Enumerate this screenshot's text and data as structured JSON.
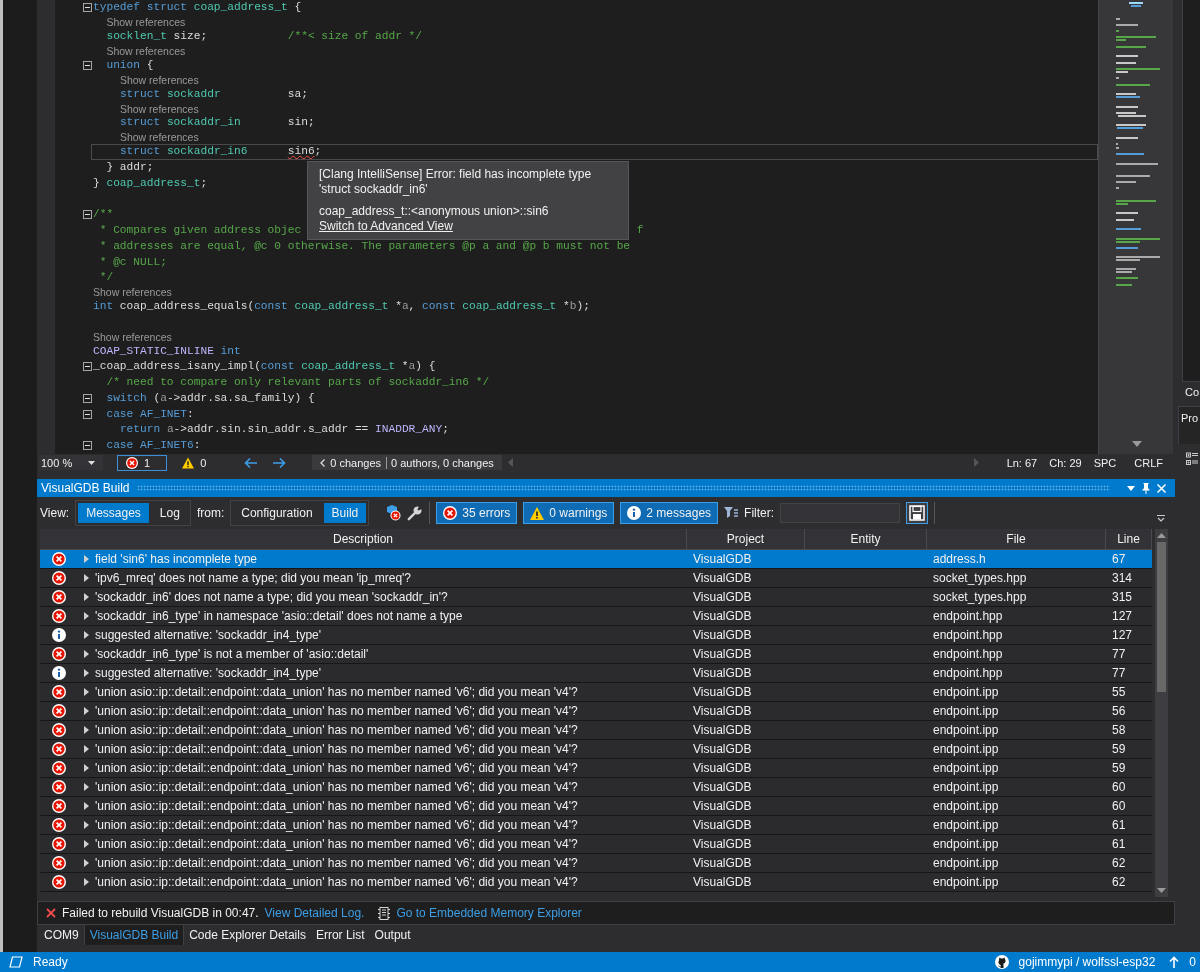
{
  "editor": {
    "lines": [
      {
        "kind": "code",
        "collapsible": true,
        "current": false,
        "tokens": [
          {
            "kind": "kw",
            "text": "typedef struct"
          },
          {
            "kind": "type",
            "text": " coap_address_t"
          },
          {
            "kind": "plain",
            "text": " {"
          }
        ],
        "children": [
          {
            "kind": "lens",
            "text": "Show references"
          },
          {
            "kind": "code",
            "collapsible": false,
            "current": false,
            "tokens": [
              {
                "kind": "type",
                "text": "socklen_t"
              },
              {
                "kind": "plain",
                "text": " size;            "
              },
              {
                "kind": "comment",
                "text": "/**< size of addr */"
              }
            ]
          },
          {
            "kind": "lens",
            "text": "Show references"
          },
          {
            "kind": "code",
            "collapsible": true,
            "current": false,
            "tokens": [
              {
                "kind": "kw",
                "text": "union"
              },
              {
                "kind": "plain",
                "text": " {"
              }
            ],
            "children": [
              {
                "kind": "lens",
                "text": "Show references"
              },
              {
                "kind": "code",
                "collapsible": false,
                "current": false,
                "tokens": [
                  {
                    "kind": "kw",
                    "text": "struct"
                  },
                  {
                    "kind": "type",
                    "text": " sockaddr"
                  },
                  {
                    "kind": "plain",
                    "text": "          sa;"
                  }
                ]
              },
              {
                "kind": "lens",
                "text": "Show references"
              },
              {
                "kind": "code",
                "collapsible": false,
                "current": false,
                "tokens": [
                  {
                    "kind": "kw",
                    "text": "struct"
                  },
                  {
                    "kind": "type",
                    "text": " sockaddr_in"
                  },
                  {
                    "kind": "plain",
                    "text": "       sin;"
                  }
                ]
              },
              {
                "kind": "lens",
                "text": "Show references"
              },
              {
                "kind": "code",
                "collapsible": false,
                "current": true,
                "tokens": [
                  {
                    "kind": "kw",
                    "text": "struct"
                  },
                  {
                    "kind": "type",
                    "text": " sockaddr_in6      "
                  },
                  {
                    "kind": "error",
                    "text": "sin6"
                  },
                  {
                    "kind": "plain",
                    "text": ";"
                  }
                ]
              }
            ]
          },
          {
            "kind": "code",
            "collapsible": false,
            "current": false,
            "tokens": [
              {
                "kind": "plain",
                "text": "} addr;"
              }
            ]
          }
        ]
      },
      {
        "kind": "code",
        "collapsible": false,
        "current": false,
        "tokens": [
          {
            "kind": "plain",
            "text": "}"
          },
          {
            "kind": "type",
            "text": " coap_address_t"
          },
          {
            "kind": "plain",
            "text": ";"
          }
        ]
      },
      {
        "kind": "blank"
      },
      {
        "kind": "code",
        "collapsible": true,
        "current": false,
        "tokens": [
          {
            "kind": "comment",
            "text": "/**"
          }
        ]
      },
      {
        "kind": "code",
        "collapsible": false,
        "current": false,
        "tokens": [
          {
            "kind": "comment",
            "text": " * Compares given address objec"
          }
        ],
        "tail": {
          "kind": "comment",
          "text": "f"
        }
      },
      {
        "kind": "code",
        "collapsible": false,
        "current": false,
        "tokens": [
          {
            "kind": "comment",
            "text": " * addresses are equal, @c 0 otherwise. The parameters @p a and @p b must not be"
          }
        ]
      },
      {
        "kind": "code",
        "collapsible": false,
        "current": false,
        "tokens": [
          {
            "kind": "comment",
            "text": " * @c NULL;"
          }
        ]
      },
      {
        "kind": "code",
        "collapsible": false,
        "current": false,
        "tokens": [
          {
            "kind": "comment",
            "text": " */"
          }
        ]
      },
      {
        "kind": "lens",
        "text": "Show references"
      },
      {
        "kind": "code",
        "collapsible": false,
        "current": false,
        "tokens": [
          {
            "kind": "kw",
            "text": "int"
          },
          {
            "kind": "plain",
            "text": " coap_address_equals("
          },
          {
            "kind": "kw",
            "text": "const"
          },
          {
            "kind": "type",
            "text": " coap_address_t"
          },
          {
            "kind": "plain",
            "text": " *"
          },
          {
            "kind": "param",
            "text": "a"
          },
          {
            "kind": "plain",
            "text": ", "
          },
          {
            "kind": "kw",
            "text": "const"
          },
          {
            "kind": "type",
            "text": " coap_address_t"
          },
          {
            "kind": "plain",
            "text": " *"
          },
          {
            "kind": "param",
            "text": "b"
          },
          {
            "kind": "plain",
            "text": ");"
          }
        ]
      },
      {
        "kind": "blank"
      },
      {
        "kind": "lens",
        "text": "Show references"
      },
      {
        "kind": "code",
        "collapsible": false,
        "current": false,
        "tokens": [
          {
            "kind": "macro",
            "text": "COAP_STATIC_INLINE"
          },
          {
            "kind": "kw",
            "text": " int"
          }
        ]
      },
      {
        "kind": "code",
        "collapsible": true,
        "current": false,
        "tokens": [
          {
            "kind": "plain",
            "text": "_coap_address_isany_impl("
          },
          {
            "kind": "kw",
            "text": "const"
          },
          {
            "kind": "type",
            "text": " coap_address_t"
          },
          {
            "kind": "plain",
            "text": " *"
          },
          {
            "kind": "param",
            "text": "a"
          },
          {
            "kind": "plain",
            "text": ") {"
          }
        ],
        "children": [
          {
            "kind": "code",
            "collapsible": false,
            "current": false,
            "tokens": [
              {
                "kind": "comment",
                "text": "/* need to compare only relevant parts of sockaddr_in6 */"
              }
            ]
          },
          {
            "kind": "code",
            "collapsible": true,
            "current": false,
            "tokens": [
              {
                "kind": "kw",
                "text": "switch"
              },
              {
                "kind": "plain",
                "text": " ("
              },
              {
                "kind": "param",
                "text": "a"
              },
              {
                "kind": "plain",
                "text": "->addr.sa.sa_family) {"
              }
            ]
          },
          {
            "kind": "code",
            "collapsible": true,
            "current": false,
            "tokens": [
              {
                "kind": "kw",
                "text": "case AF_INET"
              },
              {
                "kind": "plain",
                "text": ":"
              }
            ],
            "children": [
              {
                "kind": "code",
                "collapsible": false,
                "current": false,
                "tokens": [
                  {
                    "kind": "kw",
                    "text": "return"
                  },
                  {
                    "kind": "param",
                    "text": " a"
                  },
                  {
                    "kind": "plain",
                    "text": "->addr.sin.sin_addr.s_addr == "
                  },
                  {
                    "kind": "macro",
                    "text": "INADDR_ANY"
                  },
                  {
                    "kind": "plain",
                    "text": ";"
                  }
                ]
              }
            ]
          },
          {
            "kind": "code",
            "collapsible": true,
            "current": false,
            "tokens": [
              {
                "kind": "kw",
                "text": "case AF_INET6"
              },
              {
                "kind": "plain",
                "text": ":"
              }
            ]
          }
        ]
      }
    ],
    "tooltip": {
      "message": "[Clang IntelliSense] Error: field has incomplete type 'struct sockaddr_in6'",
      "symbol": "coap_address_t::<anonymous union>::sin6",
      "link": "Switch to Advanced View"
    },
    "status": {
      "zoom": "100 %",
      "counters": [
        {
          "kind": "error",
          "count": "1",
          "focused": true
        },
        {
          "kind": "warning",
          "count": "0",
          "focused": false
        }
      ],
      "changes": "0 changes",
      "authors": "0 authors, 0 changes",
      "line": "Ln: 67",
      "column": "Ch: 29",
      "indent": "SPC",
      "line_endings": "CRLF"
    }
  },
  "side_panel": {
    "header": "Co",
    "tab": "Pro"
  },
  "build_panel": {
    "title": "VisualGDB Build",
    "toolbar": {
      "view_label": "View:",
      "view_tabs": [
        {
          "label": "Messages",
          "selected": true
        },
        {
          "label": "Log",
          "selected": false
        }
      ],
      "from_label": "from:",
      "from_tabs": [
        {
          "label": "Configuration",
          "selected": false
        },
        {
          "label": "Build",
          "selected": true
        }
      ],
      "filters": [
        {
          "kind": "error",
          "label": "35 errors",
          "on": true
        },
        {
          "kind": "warning",
          "label": "0 warnings",
          "on": true
        },
        {
          "kind": "info",
          "label": "2 messages",
          "on": true
        }
      ],
      "filter_label": "Filter:"
    },
    "table": {
      "columns": [
        "Description",
        "Project",
        "Entity",
        "File",
        "Line"
      ],
      "rows": [
        {
          "kind": "error",
          "selected": true,
          "expanded": false,
          "description": "field 'sin6' has incomplete type",
          "project": "VisualGDB",
          "file": "address.h",
          "line": "67"
        },
        {
          "kind": "error",
          "selected": false,
          "expanded": false,
          "description": "'ipv6_mreq' does not name a type; did you mean 'ip_mreq'?",
          "project": "VisualGDB",
          "file": "socket_types.hpp",
          "line": "314"
        },
        {
          "kind": "error",
          "selected": false,
          "expanded": false,
          "description": "'sockaddr_in6' does not name a type; did you mean 'sockaddr_in'?",
          "project": "VisualGDB",
          "file": "socket_types.hpp",
          "line": "315"
        },
        {
          "kind": "error",
          "selected": false,
          "expanded": false,
          "description": "'sockaddr_in6_type' in namespace 'asio::detail' does not name a type",
          "project": "VisualGDB",
          "file": "endpoint.hpp",
          "line": "127"
        },
        {
          "kind": "info",
          "selected": false,
          "expanded": false,
          "description": "suggested alternative: 'sockaddr_in4_type'",
          "project": "VisualGDB",
          "file": "endpoint.hpp",
          "line": "127"
        },
        {
          "kind": "error",
          "selected": false,
          "expanded": false,
          "description": "'sockaddr_in6_type' is not a member of 'asio::detail'",
          "project": "VisualGDB",
          "file": "endpoint.hpp",
          "line": "77"
        },
        {
          "kind": "info",
          "selected": false,
          "expanded": false,
          "description": "suggested alternative: 'sockaddr_in4_type'",
          "project": "VisualGDB",
          "file": "endpoint.hpp",
          "line": "77"
        },
        {
          "kind": "error",
          "selected": false,
          "expanded": false,
          "description": "'union asio::ip::detail::endpoint::data_union' has no member named 'v6'; did you mean 'v4'?",
          "project": "VisualGDB",
          "file": "endpoint.ipp",
          "line": "55"
        },
        {
          "kind": "error",
          "selected": false,
          "expanded": false,
          "description": "'union asio::ip::detail::endpoint::data_union' has no member named 'v6'; did you mean 'v4'?",
          "project": "VisualGDB",
          "file": "endpoint.ipp",
          "line": "56"
        },
        {
          "kind": "error",
          "selected": false,
          "expanded": false,
          "description": "'union asio::ip::detail::endpoint::data_union' has no member named 'v6'; did you mean 'v4'?",
          "project": "VisualGDB",
          "file": "endpoint.ipp",
          "line": "58"
        },
        {
          "kind": "error",
          "selected": false,
          "expanded": false,
          "description": "'union asio::ip::detail::endpoint::data_union' has no member named 'v6'; did you mean 'v4'?",
          "project": "VisualGDB",
          "file": "endpoint.ipp",
          "line": "59"
        },
        {
          "kind": "error",
          "selected": false,
          "expanded": false,
          "description": "'union asio::ip::detail::endpoint::data_union' has no member named 'v6'; did you mean 'v4'?",
          "project": "VisualGDB",
          "file": "endpoint.ipp",
          "line": "59"
        },
        {
          "kind": "error",
          "selected": false,
          "expanded": false,
          "description": "'union asio::ip::detail::endpoint::data_union' has no member named 'v6'; did you mean 'v4'?",
          "project": "VisualGDB",
          "file": "endpoint.ipp",
          "line": "60"
        },
        {
          "kind": "error",
          "selected": false,
          "expanded": false,
          "description": "'union asio::ip::detail::endpoint::data_union' has no member named 'v6'; did you mean 'v4'?",
          "project": "VisualGDB",
          "file": "endpoint.ipp",
          "line": "60"
        },
        {
          "kind": "error",
          "selected": false,
          "expanded": false,
          "description": "'union asio::ip::detail::endpoint::data_union' has no member named 'v6'; did you mean 'v4'?",
          "project": "VisualGDB",
          "file": "endpoint.ipp",
          "line": "61"
        },
        {
          "kind": "error",
          "selected": false,
          "expanded": false,
          "description": "'union asio::ip::detail::endpoint::data_union' has no member named 'v6'; did you mean 'v4'?",
          "project": "VisualGDB",
          "file": "endpoint.ipp",
          "line": "61"
        },
        {
          "kind": "error",
          "selected": false,
          "expanded": false,
          "description": "'union asio::ip::detail::endpoint::data_union' has no member named 'v6'; did you mean 'v4'?",
          "project": "VisualGDB",
          "file": "endpoint.ipp",
          "line": "62"
        },
        {
          "kind": "error",
          "selected": false,
          "expanded": false,
          "description": "'union asio::ip::detail::endpoint::data_union' has no member named 'v6'; did you mean 'v4'?",
          "project": "VisualGDB",
          "file": "endpoint.ipp",
          "line": "62"
        }
      ]
    },
    "footer": {
      "message": "Failed to rebuild VisualGDB in 00:47.",
      "links": [
        {
          "kind": "log",
          "label": "View Detailed Log."
        },
        {
          "kind": "memory",
          "label": "Go to Embedded Memory Explorer"
        }
      ]
    }
  },
  "bottom_tabs": [
    {
      "label": "COM9",
      "selected": false
    },
    {
      "label": "VisualGDB Build",
      "selected": true
    },
    {
      "label": "Code Explorer Details",
      "selected": false
    },
    {
      "label": "Error List",
      "selected": false
    },
    {
      "label": "Output",
      "selected": false
    }
  ],
  "status_bar": {
    "status": "Ready",
    "repo": "gojimmypi / wolfssl-esp32",
    "pushes": "0"
  }
}
